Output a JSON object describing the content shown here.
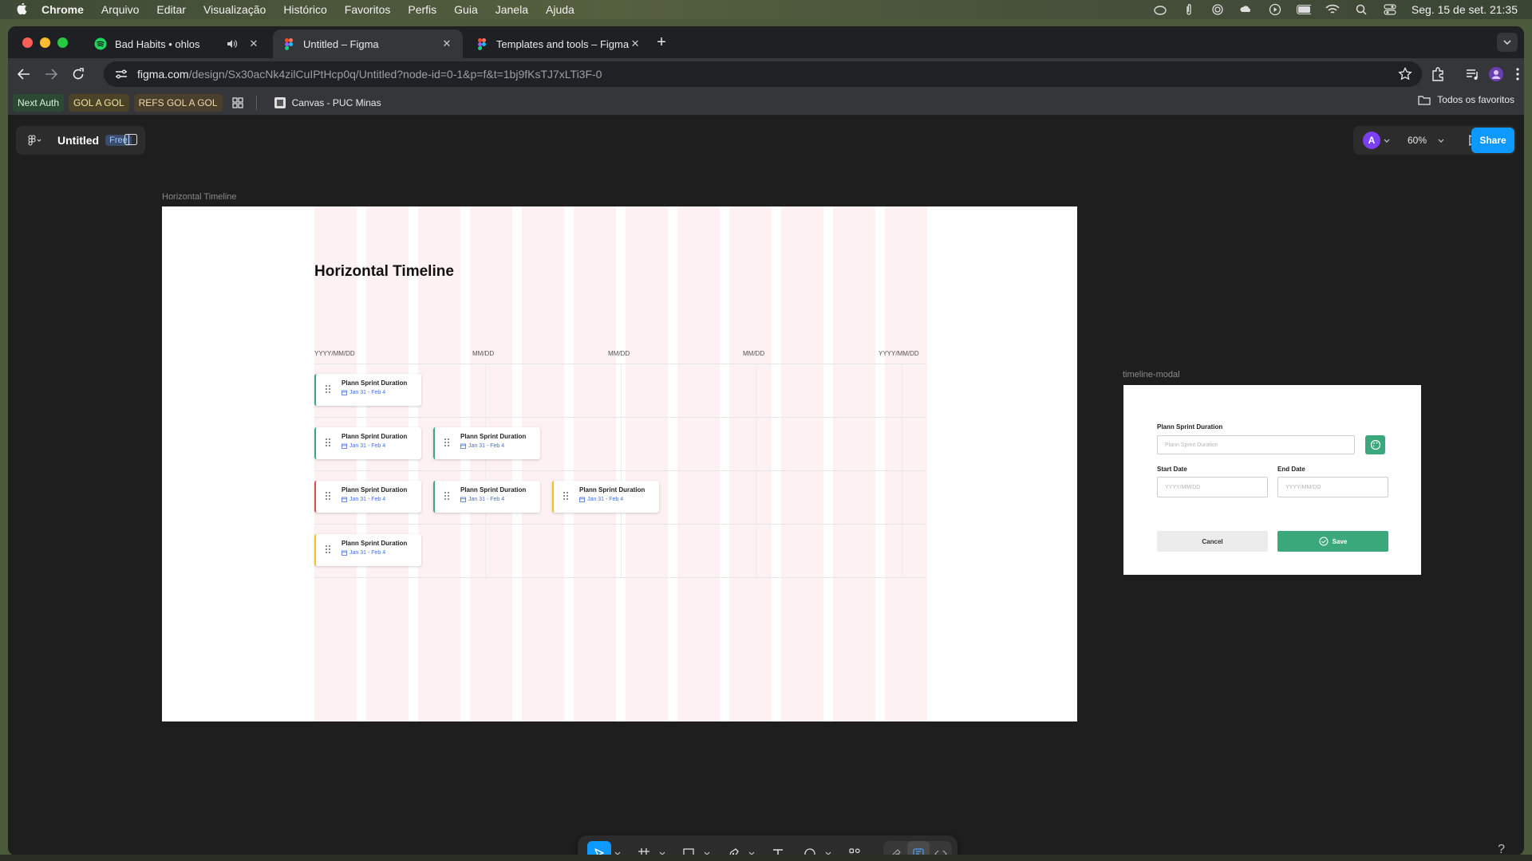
{
  "menubar": {
    "app": "Chrome",
    "items": [
      "Arquivo",
      "Editar",
      "Visualização",
      "Histórico",
      "Favoritos",
      "Perfis",
      "Guia",
      "Janela",
      "Ajuda"
    ],
    "clock": "Seg. 15 de set.  21:35"
  },
  "tabs": [
    {
      "title": "Bad Habits • ohlos",
      "icon": "spotify-icon"
    },
    {
      "title": "Untitled – Figma",
      "icon": "figma-icon"
    },
    {
      "title": "Templates and tools – Figma",
      "icon": "figma-icon"
    }
  ],
  "omnibox": {
    "host": "figma.com",
    "path": "/design/Sx30acNk4zilCuIPtHcp0q/Untitled?node-id=0-1&p=f&t=1bj9fKsTJ7xLTi3F-0"
  },
  "bookmarks": {
    "items": [
      "Next Auth",
      "GOL A GOL",
      "REFS GOL A GOL"
    ],
    "canvas": "Canvas - PUC Minas",
    "all": "Todos os favoritos"
  },
  "figma": {
    "file_name": "Untitled",
    "plan_badge": "Free",
    "avatar_initial": "A",
    "zoom": "60%",
    "share": "Share"
  },
  "timeline_frame": {
    "label": "Horizontal Timeline",
    "title": "Horizontal Timeline",
    "dates": [
      "YYYY/MM/DD",
      "MM/DD",
      "MM/DD",
      "MM/DD",
      "YYYY/MM/DD"
    ],
    "card_title": "Plann Sprint Duration",
    "card_date": "Jan 31 - Feb 4",
    "accent_colors": {
      "green": "#3aa87b",
      "red": "#d94a4a",
      "yellow": "#f2c21b"
    }
  },
  "modal": {
    "label": "timeline-modal",
    "name_label": "Plann Sprint Duration",
    "name_placeholder": "Plann Sprint Duration",
    "start_label": "Start Date",
    "end_label": "End Date",
    "date_placeholder": "YYYY/MM/DD",
    "cancel": "Cancel",
    "save": "Save"
  },
  "help": "?"
}
